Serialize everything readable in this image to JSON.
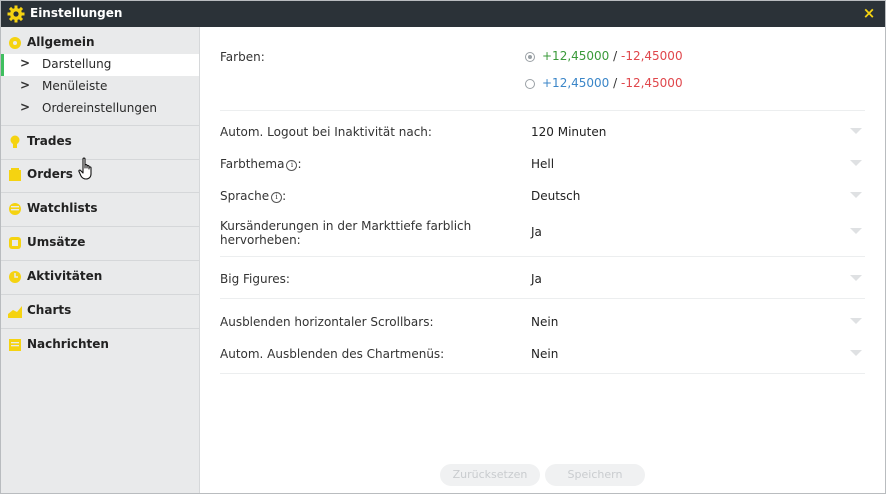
{
  "window": {
    "title": "Einstellungen",
    "close_label": "×"
  },
  "sidebar": {
    "categories": [
      {
        "label": "Allgemein",
        "icon": "settings-icon"
      },
      {
        "label": "Trades",
        "icon": "trades-icon"
      },
      {
        "label": "Orders",
        "icon": "orders-icon"
      },
      {
        "label": "Watchlists",
        "icon": "watchlists-icon"
      },
      {
        "label": "Umsätze",
        "icon": "umsaetze-icon"
      },
      {
        "label": "Aktivitäten",
        "icon": "aktivitaeten-icon"
      },
      {
        "label": "Charts",
        "icon": "charts-icon"
      },
      {
        "label": "Nachrichten",
        "icon": "nachrichten-icon"
      }
    ],
    "subitems": [
      {
        "label": "Darstellung"
      },
      {
        "label": "Menüleiste"
      },
      {
        "label": "Ordereinstellungen"
      }
    ]
  },
  "settings": {
    "colors_label": "Farben:",
    "color_option_1": {
      "positive": "+12,45000",
      "sep": " / ",
      "negative": "-12,45000"
    },
    "color_option_2": {
      "positive": "+12,45000",
      "sep": " / ",
      "negative": "-12,45000"
    },
    "logout_label": "Autom. Logout bei Inaktivität nach:",
    "logout_value": "120 Minuten",
    "theme_label": "Farbthema",
    "theme_value": "Hell",
    "language_label": "Sprache",
    "language_value": "Deutsch",
    "depth_label_1": "Kursänderungen in der Markttiefe farblich",
    "depth_label_2": "hervorheben:",
    "depth_value": "Ja",
    "bigfig_label": "Big Figures:",
    "bigfig_value": "Ja",
    "scroll_label": "Ausblenden horizontaler Scrollbars:",
    "scroll_value": "Nein",
    "chartmenu_label": "Autom. Ausblenden des Chartmenüs:",
    "chartmenu_value": "Nein",
    "info_glyph": "i"
  },
  "buttons": {
    "reset": "Zurücksetzen",
    "save": "Speichern"
  },
  "colors": {
    "positive_green": "#3a9a3a",
    "positive_blue": "#3b86c8",
    "negative_red": "#e0474c",
    "accent_yellow": "#f5d311",
    "active_green": "#3fbf5f"
  }
}
